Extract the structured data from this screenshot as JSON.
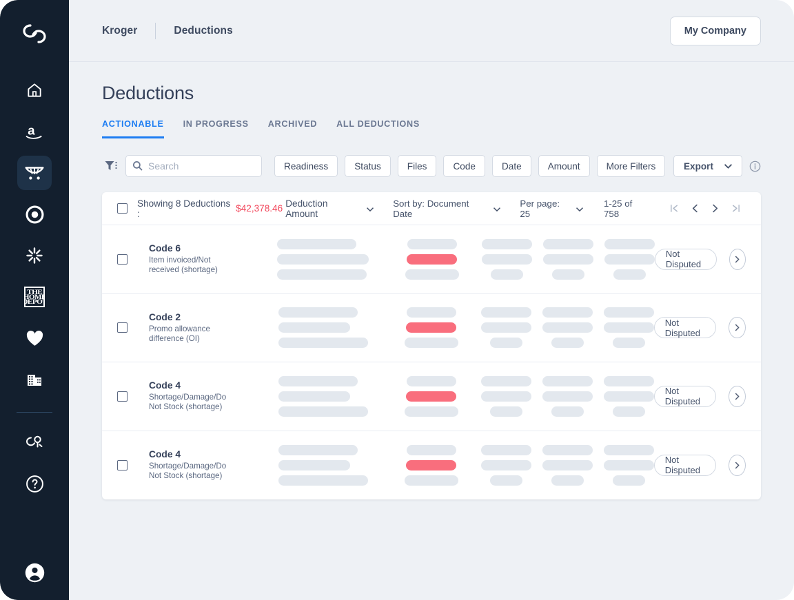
{
  "sidebar": {
    "logo_icon": "brand-loop-logo",
    "items": [
      {
        "icon": "home-icon",
        "name": "home",
        "active": false
      },
      {
        "icon": "amazon-logo-icon",
        "name": "amazon",
        "active": false
      },
      {
        "icon": "kroger-cart-icon",
        "name": "kroger",
        "active": true
      },
      {
        "icon": "target-bullseye-icon",
        "name": "target",
        "active": false
      },
      {
        "icon": "walmart-spark-icon",
        "name": "walmart",
        "active": false
      },
      {
        "icon": "home-depot-icon",
        "name": "home-depot",
        "active": false,
        "label": "THE HOME DEPOT"
      },
      {
        "icon": "heart-icon",
        "name": "favorites",
        "active": false
      },
      {
        "icon": "building-icon",
        "name": "company",
        "active": false
      }
    ],
    "secondary_items": [
      {
        "icon": "users-group-icon",
        "name": "team"
      },
      {
        "icon": "help-circle-icon",
        "name": "help"
      }
    ],
    "account_icon": "account-avatar-icon"
  },
  "topbar": {
    "breadcrumb": {
      "root": "Kroger",
      "current": "Deductions"
    },
    "company_button": "My Company"
  },
  "page": {
    "title": "Deductions",
    "tabs": [
      {
        "label": "ACTIONABLE",
        "active": true
      },
      {
        "label": "IN PROGRESS",
        "active": false
      },
      {
        "label": "ARCHIVED",
        "active": false
      },
      {
        "label": "ALL DEDUCTIONS",
        "active": false
      }
    ]
  },
  "filters": {
    "filter_icon": "filter-funnel-icon",
    "search": {
      "placeholder": "Search",
      "value": ""
    },
    "chips": [
      "Readiness",
      "Status",
      "Files",
      "Code",
      "Date",
      "Amount",
      "More Filters"
    ],
    "export_label": "Export",
    "info_icon": "info-circle-icon"
  },
  "table": {
    "summary_prefix": "Showing 8 Deductions  :",
    "summary_amount": "$42,378.46",
    "summary_metric": "Deduction Amount",
    "sort_by": "Sort by: Document Date",
    "per_page": "Per page: 25",
    "range": "1-25 of 758",
    "pager": {
      "first": "|<",
      "prev": "<",
      "next": ">",
      "last": ">|"
    },
    "rows": [
      {
        "code": "Code 6",
        "description": "Item invoiced/Not received (shortage)",
        "status": "Not Disputed",
        "go_icon": "chevron-right-icon",
        "skeleton": {
          "a": [
            115,
            133,
            130
          ],
          "b": [
            72,
            73,
            78
          ],
          "c": [
            73,
            73,
            47
          ],
          "d": [
            73,
            73,
            47
          ],
          "e": [
            73,
            73,
            47
          ]
        }
      },
      {
        "code": "Code 2",
        "description": "Promo allowance difference (OI)",
        "status": "Not Disputed",
        "go_icon": "chevron-right-icon",
        "skeleton": {
          "a": [
            115,
            104,
            130
          ],
          "b": [
            72,
            73,
            78
          ],
          "c": [
            73,
            73,
            47
          ],
          "d": [
            73,
            73,
            47
          ],
          "e": [
            73,
            73,
            47
          ]
        }
      },
      {
        "code": "Code 4",
        "description": "Shortage/Damage/Do Not Stock (shortage)",
        "status": "Not Disputed",
        "go_icon": "chevron-right-icon",
        "skeleton": {
          "a": [
            115,
            104,
            130
          ],
          "b": [
            72,
            73,
            78
          ],
          "c": [
            73,
            73,
            47
          ],
          "d": [
            73,
            73,
            47
          ],
          "e": [
            73,
            73,
            47
          ]
        }
      },
      {
        "code": "Code 4",
        "description": "Shortage/Damage/Do Not Stock (shortage)",
        "status": "Not Disputed",
        "go_icon": "chevron-right-icon",
        "skeleton": {
          "a": [
            115,
            104,
            130
          ],
          "b": [
            72,
            73,
            78
          ],
          "c": [
            73,
            73,
            47
          ],
          "d": [
            73,
            73,
            47
          ],
          "e": [
            73,
            73,
            47
          ]
        }
      }
    ]
  },
  "colors": {
    "sidebar_bg": "#131f2e",
    "sidebar_active": "#1e3248",
    "page_bg": "#eef1f5",
    "accent_blue": "#1d7df2",
    "alert_red": "#f24a5e",
    "skeleton_gray": "#e3e8ee",
    "skeleton_red": "#f96e7d",
    "text_dark": "#35415a"
  }
}
